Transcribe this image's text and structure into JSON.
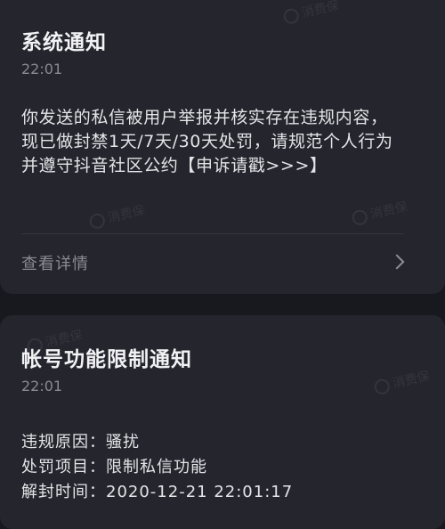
{
  "notifications": [
    {
      "title": "系统通知",
      "time": "22:01",
      "body_lines": [
        "你发送的私信被用户举报并核实存在违规内容，",
        "现已做封禁1天/7天/30天处罚，请规范个人行为",
        "并遵守抖音社区公约【申诉请戳>>>】"
      ],
      "details_label": "查看详情",
      "chevron_icon": "chevron-right-icon"
    },
    {
      "title": "帐号功能限制通知",
      "time": "22:01",
      "rows": [
        "违规原因：骚扰",
        "处罚项目：限制私信功能",
        "解封时间：2020-12-21 22:01:17"
      ]
    }
  ],
  "watermark": {
    "text": "消费保"
  },
  "colors": {
    "background": "#18181f",
    "card": "#25252e",
    "primary_text": "#f2f2f4",
    "secondary_text": "#8a8a93"
  }
}
